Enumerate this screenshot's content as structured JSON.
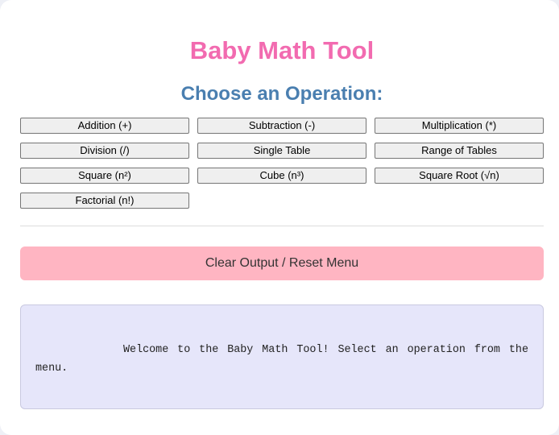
{
  "header": {
    "title": "Baby Math Tool",
    "subtitle": "Choose an Operation:"
  },
  "operations": [
    {
      "label": "Addition (+)"
    },
    {
      "label": "Subtraction (-)"
    },
    {
      "label": "Multiplication (*)"
    },
    {
      "label": "Division (/)"
    },
    {
      "label": "Single Table"
    },
    {
      "label": "Range of Tables"
    },
    {
      "label": "Square (n²)"
    },
    {
      "label": "Cube (n³)"
    },
    {
      "label": "Square Root (√n)"
    },
    {
      "label": "Factorial (n!)"
    }
  ],
  "actions": {
    "clear_label": "Clear Output / Reset Menu"
  },
  "output": {
    "text": "Welcome to the Baby Math Tool! Select an operation from the menu."
  },
  "colors": {
    "title": "#f26bb0",
    "subtitle": "#4a7fb0",
    "clear_button": "#ffb5c2",
    "output_background": "#e6e6fa"
  }
}
